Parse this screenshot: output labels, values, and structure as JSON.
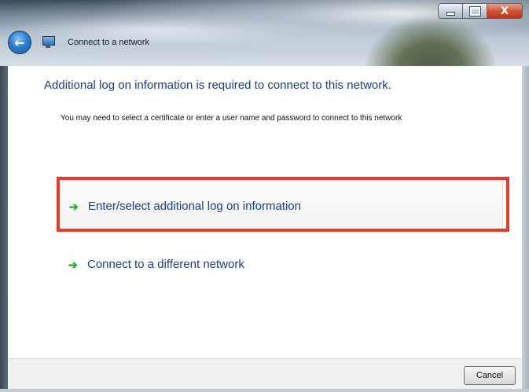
{
  "window": {
    "title": "Connect to a network",
    "caption_buttons": {
      "minimize_icon": "minimize-icon",
      "maximize_icon": "maximize-icon",
      "close_label": "X"
    }
  },
  "nav": {
    "back_icon": "back-arrow-icon",
    "app_icon": "network-icon"
  },
  "content": {
    "heading": "Additional log on information is required to connect to this network.",
    "description": "You may need to select a certificate or enter a user name and password to connect to this network",
    "options": [
      {
        "label": "Enter/select additional log on information",
        "icon": "green-arrow-icon",
        "highlighted": true
      },
      {
        "label": "Connect to a different network",
        "icon": "green-arrow-icon",
        "highlighted": false
      }
    ]
  },
  "footer": {
    "cancel_label": "Cancel"
  },
  "colors": {
    "heading": "#1c3d8c",
    "link": "#1c3d8c",
    "arrow": "#29a52c",
    "highlight": "#e33b2c"
  }
}
